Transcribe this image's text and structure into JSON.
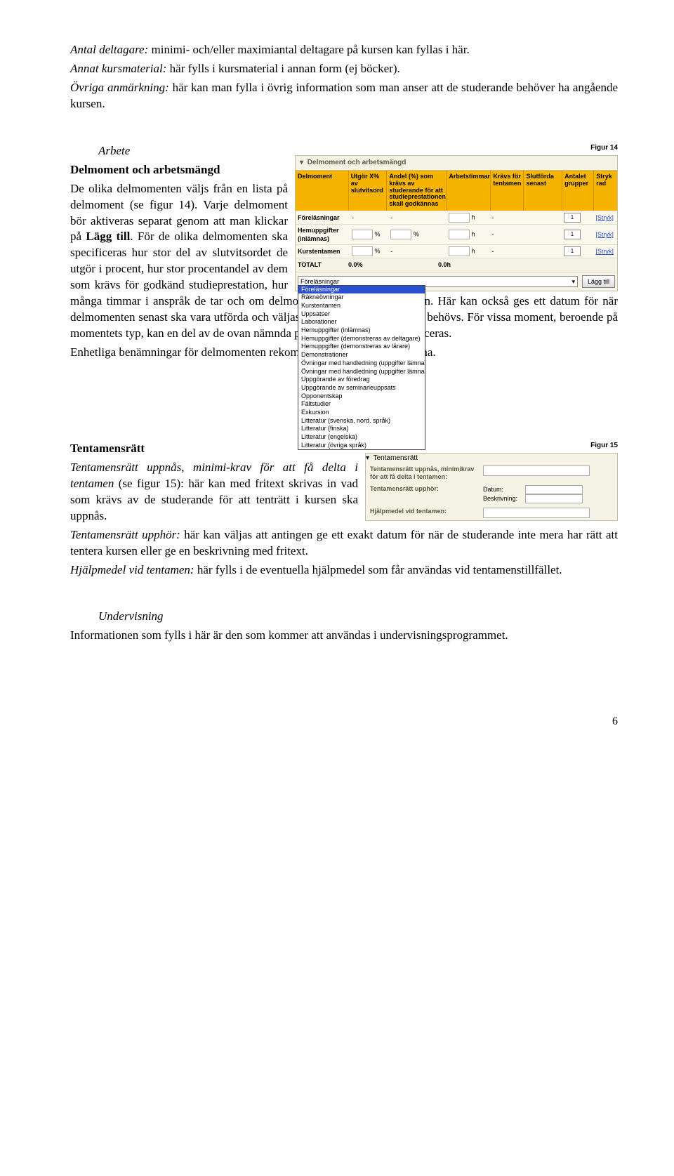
{
  "intro": {
    "p1_i": "Antal deltagare:",
    "p1": " minimi- och/eller maximiantal deltagare på kursen kan fyllas i här.",
    "p2_i": "Annat kursmaterial:",
    "p2": " här fylls i kursmaterial i annan form (ej böcker).",
    "p3_i": "Övriga anmärkning:",
    "p3": " här kan man fylla i övrig information som man anser att de studerande behöver ha angående kursen."
  },
  "fig14": {
    "label": "Figur 14",
    "heading_i": "Arbete",
    "h1b": "Delmoment och arbetsmängd",
    "body1": "De olika delmomenten väljs från en lista på delmoment (se figur 14). Varje delmoment bör aktiveras separat genom att man klickar på ",
    "bold1": "Lägg till",
    "body2": ". För de olika delmomenten ska specificeras hur stor del av slutvitsordet de utgör i procent, hur stor procentandel av dem som krävs för godkänd studieprestation, hur många timmar i anspråk de tar och om delmomenten krävs för tentamen. Här kan också ges ett datum för när delmomenten senast ska vara utförda och väljas flera grupper ifall sådana behövs. För vissa moment, beroende på momentets typ, kan en del av de ovan nämnda procentsatserna inte specificeras.",
    "body3": "Enhetliga benämningar för delmomenten rekommenderas inom fakulteterna.",
    "panel_title": "Delmoment och arbetsmängd",
    "headers": {
      "del": "Delmoment",
      "utg": "Utgör X% av slutvitsord",
      "and": "Andel (%) som krävs av studerande för att studieprestationen skall godkännas",
      "arb": "Arbetstimmar",
      "kra": "Krävs för tentamen",
      "slu": "Slutförda senast",
      "ant": "Antalet grupper",
      "str": "Stryk rad"
    },
    "rows": [
      {
        "name": "Föreläsningar"
      },
      {
        "name": "Hemuppgifter (inlämnas)"
      },
      {
        "name": "Kurstentamen"
      }
    ],
    "pct": "%",
    "h": "h",
    "dash": "-",
    "one": "1",
    "stryk": "[Stryk]",
    "tot_label": "TOTALT",
    "tot_pct": "0.0%",
    "tot_h": "0.0h",
    "add_sel": "Föreläsningar",
    "add_btn": "Lägg till",
    "options": [
      "Föreläsningar",
      "Räkneövningar",
      "Kurstentamen",
      "Uppsatser",
      "Laborationer",
      "Hemuppgifter (inlämnas)",
      "Hemuppgifter (demonstreras av deltagare)",
      "Hemuppgifter (demonstreras av lärare)",
      "Demonstrationer",
      "Övningar med handledning (uppgifter lämnas in)",
      "Övningar med handledning (uppgifter lämnas inte in)",
      "Uppgörande av föredrag",
      "Uppgörande av seminarieuppsats",
      "Opponentskap",
      "Fältstudier",
      "Exkursion",
      "Litteratur (svenska, nord. språk)",
      "Litteratur (finska)",
      "Litteratur (engelska)",
      "Litteratur (övriga språk)"
    ]
  },
  "fig15": {
    "label": "Figur 15",
    "h1b": "Tentamensrätt",
    "i1": "Tentamensrätt uppnås, minimi-krav för att få delta i tentamen",
    "b1": " (se figur 15): här kan med fritext skrivas in vad som krävs av de studerande för att tenträtt i kursen ska uppnås.",
    "i2": "Tentamensrätt upphör:",
    "b2": " här kan väljas att antingen ge ett exakt datum för när de studerande inte mera har rätt att tentera kursen eller ge en beskrivning med fritext.",
    "i3": "Hjälpmedel vid tentamen:",
    "b3": " här fylls i de eventuella hjälpmedel som får användas vid tentamenstillfället.",
    "panel_title": "Tentamensrätt",
    "lbl1": "Tentamensrätt uppnås, minimikrav för att få delta i tentamen:",
    "lbl2": "Tentamensrätt upphör:",
    "sub_dat": "Datum:",
    "sub_besk": "Beskrivning:",
    "lbl3": "Hjälpmedel vid tentamen:"
  },
  "underv": {
    "h_i": "Undervisning",
    "p": "Informationen som fylls i här är den som kommer att användas i undervisningsprogrammet."
  },
  "page": "6"
}
